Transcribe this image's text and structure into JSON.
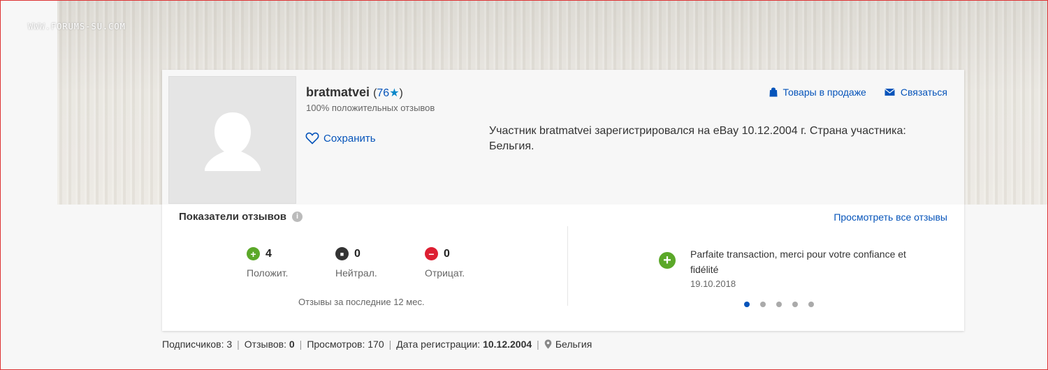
{
  "watermark": "WWW.FORUMS-SU.COM",
  "profile": {
    "username": "bratmatvei",
    "score_open": "(",
    "score": "76",
    "score_star": "★",
    "score_close": ")",
    "positive_feedback": "100% положительных отзывов",
    "save_label": "Сохранить",
    "registration_text": "Участник bratmatvei зарегистрировался на eBay 10.12.2004 г. Страна участника: Бельгия.",
    "links": {
      "items_for_sale": "Товары в продаже",
      "contact": "Связаться"
    }
  },
  "feedback": {
    "title": "Показатели отзывов",
    "info_icon": "i",
    "view_all": "Просмотреть все отзывы",
    "counts": [
      {
        "value": "4",
        "label": "Положит.",
        "icon": "plus-icon",
        "color": "#5ba829",
        "glyph": "+"
      },
      {
        "value": "0",
        "label": "Нейтрал.",
        "icon": "neutral-icon",
        "color": "#333333",
        "glyph": "■"
      },
      {
        "value": "0",
        "label": "Отрицат.",
        "icon": "minus-icon",
        "color": "#dd1e31",
        "glyph": "−"
      }
    ],
    "period_label": "Отзывы за последние 12 мес.",
    "latest_review": {
      "text": "Parfaite transaction, merci pour votre confiance et fidélité",
      "date": "19.10.2018"
    },
    "carousel_pages": 5,
    "carousel_active": 1
  },
  "stats": {
    "followers_label": "Подписчиков:",
    "followers_value": "3",
    "reviews_label": "Отзывов:",
    "reviews_value": "0",
    "views_label": "Просмотров:",
    "views_value": "170",
    "reg_label": "Дата регистрации:",
    "reg_value": "10.12.2004",
    "country": "Бельгия"
  },
  "colors": {
    "link": "#0654ba",
    "positive": "#5ba829",
    "negative": "#dd1e31",
    "neutral": "#333333"
  }
}
